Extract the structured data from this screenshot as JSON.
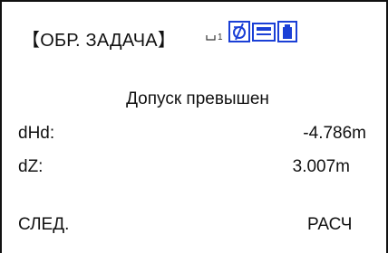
{
  "header": {
    "title": "【ОБР. ЗАДАЧА】",
    "status_icons": [
      {
        "name": "measure-mode-icon",
        "label": "1"
      },
      {
        "name": "no-prism-icon"
      },
      {
        "name": "battery-level-icon"
      },
      {
        "name": "battery-icon"
      }
    ],
    "icon_color": "#1a3fd6"
  },
  "message": "Допуск превышен",
  "readings": [
    {
      "label": "dHd:",
      "value": "-4.786m"
    },
    {
      "label": "dZ:",
      "value": "3.007m"
    }
  ],
  "softkeys": {
    "left": "СЛЕД.",
    "right": "РАСЧ"
  }
}
